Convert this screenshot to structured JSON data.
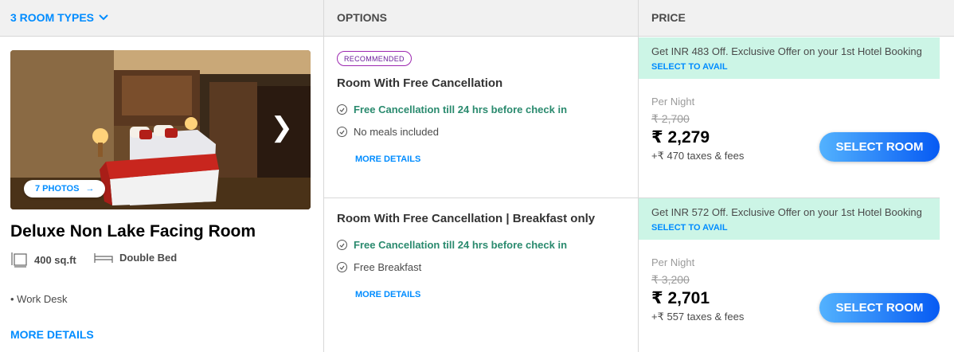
{
  "header": {
    "room_types": "3 ROOM TYPES",
    "options": "OPTIONS",
    "price": "PRICE"
  },
  "room": {
    "photos_label": "7 PHOTOS",
    "title": "Deluxe Non Lake Facing Room",
    "size": "400 sq.ft",
    "bed": "Double Bed",
    "amenity": "Work Desk",
    "more_details": "MORE DETAILS"
  },
  "options": [
    {
      "tag": "RECOMMENDED",
      "title": "Room With Free Cancellation",
      "lines": [
        {
          "text": "Free Cancellation till 24 hrs before check in",
          "style": "green"
        },
        {
          "text": "No meals included",
          "style": "grey"
        }
      ],
      "more_details": "MORE DETAILS",
      "offer_text": "Get INR 483 Off. Exclusive Offer on your 1st Hotel Booking",
      "offer_link": "SELECT TO AVAIL",
      "per_night": "Per Night",
      "old_price": "₹ 2,700",
      "new_price": "₹ 2,279",
      "taxes": "+₹ 470 taxes & fees",
      "button": "SELECT ROOM"
    },
    {
      "tag": "",
      "title": "Room With Free Cancellation | Breakfast only",
      "lines": [
        {
          "text": "Free Cancellation till 24 hrs before check in",
          "style": "green"
        },
        {
          "text": "Free Breakfast",
          "style": "grey"
        }
      ],
      "more_details": "MORE DETAILS",
      "offer_text": "Get INR 572 Off. Exclusive Offer on your 1st Hotel Booking",
      "offer_link": "SELECT TO AVAIL",
      "per_night": "Per Night",
      "old_price": "₹ 3,200",
      "new_price": "₹ 2,701",
      "taxes": "+₹ 557 taxes & fees",
      "button": "SELECT ROOM"
    }
  ],
  "colors": {
    "accent": "#008cff",
    "green_text": "#2a8a6e",
    "offer_bg": "#ccf5e6",
    "button_start": "#53b2fe",
    "button_end": "#065af3"
  }
}
